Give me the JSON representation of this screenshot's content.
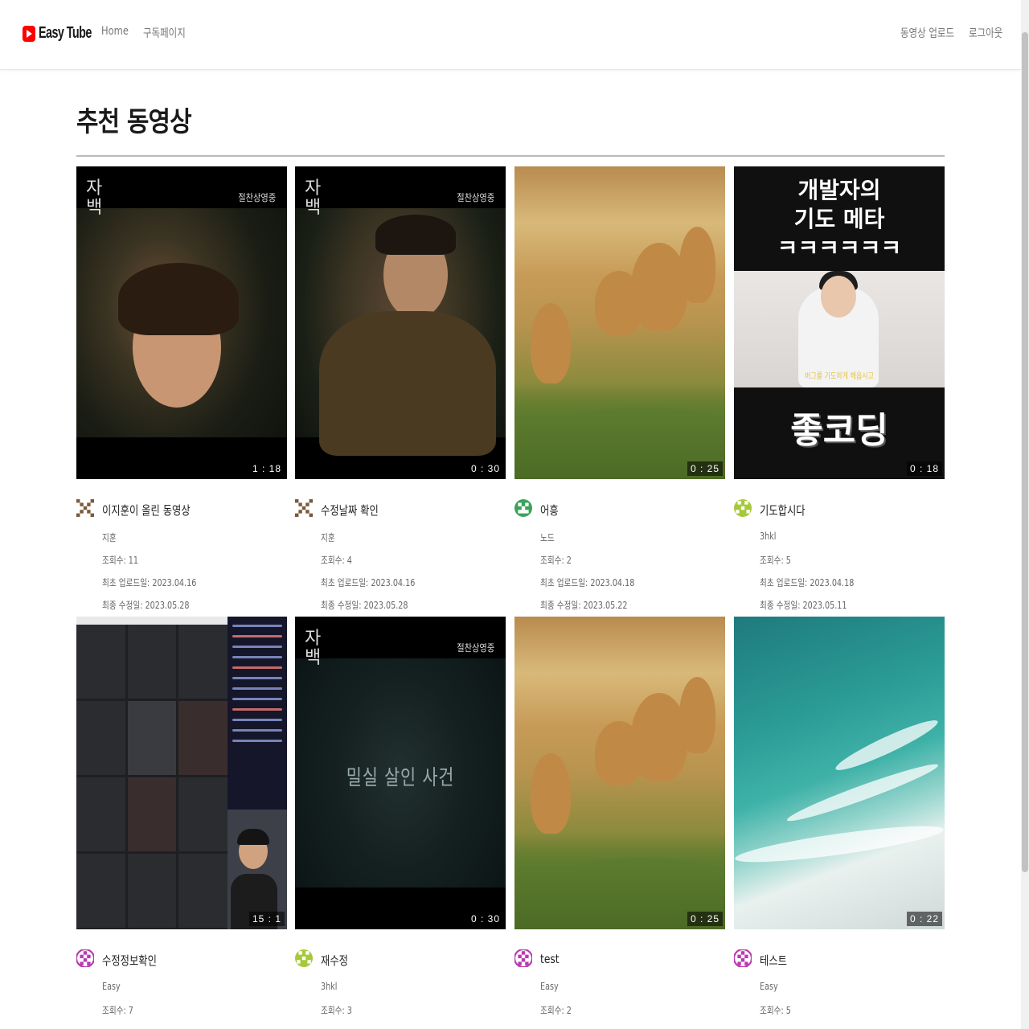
{
  "header": {
    "brand": "Easy Tube",
    "nav": {
      "home": "Home",
      "subscriptions": "구독페이지"
    },
    "actions": {
      "upload": "동영상 업로드",
      "logout": "로그아웃"
    }
  },
  "main": {
    "section_title": "추천 동영상",
    "videos": [
      {
        "title": "이지훈이 올린 동영상",
        "channel": "지훈",
        "views": "조회수: 11",
        "uploaded": "최초 업로드일: 2023.04.16",
        "modified": "최종 수정일: 2023.05.28",
        "duration": "1 : 18",
        "avatar_color": "#7a5a3a",
        "film_logo": "자백",
        "film_tag": "절찬상영중"
      },
      {
        "title": "수정날짜 확인",
        "channel": "지훈",
        "views": "조회수: 4",
        "uploaded": "최초 업로드일: 2023.04.16",
        "modified": "최종 수정일: 2023.05.28",
        "duration": "0 : 30",
        "avatar_color": "#7a5a3a",
        "film_logo": "자백",
        "film_tag": "절찬상영중"
      },
      {
        "title": "어흥",
        "channel": "노드",
        "views": "조회수: 2",
        "uploaded": "최초 업로드일: 2023.04.18",
        "modified": "최종 수정일: 2023.05.22",
        "duration": "0 : 25",
        "avatar_color": "#3aa35a"
      },
      {
        "title": "기도합시다",
        "channel": "3hkl",
        "views": "조회수: 5",
        "uploaded": "최초 업로드일: 2023.04.18",
        "modified": "최종 수정일: 2023.05.11",
        "duration": "0 : 18",
        "avatar_color": "#a6c93a",
        "thumb_text_top": "개발자의\n기도 메타\nㅋㅋㅋㅋㅋㅋ",
        "thumb_caption": "버그를 기도하게 해옵시고",
        "thumb_text_bottom": "좋코딩"
      },
      {
        "title": "수정정보확인",
        "channel": "Easy",
        "views": "조회수: 7",
        "duration": "15 : 1",
        "avatar_color": "#b83ab0"
      },
      {
        "title": "재수정",
        "channel": "3hkl",
        "views": "조회수: 3",
        "duration": "0 : 30",
        "avatar_color": "#a6c93a",
        "film_logo": "자백",
        "film_tag": "절찬상영중",
        "thumb_center": "밀실 살인 사건"
      },
      {
        "title": "test",
        "channel": "Easy",
        "views": "조회수: 2",
        "duration": "0 : 25",
        "avatar_color": "#b83ab0"
      },
      {
        "title": "테스트",
        "channel": "Easy",
        "views": "조회수: 5",
        "duration": "0 : 22",
        "avatar_color": "#b83ab0"
      }
    ]
  },
  "colors": {
    "brand_red": "#ff0000",
    "divider": "#b9b9b9"
  },
  "icons": {
    "logo": "play-logo-icon",
    "avatar": "identicon-avatar-icon"
  }
}
